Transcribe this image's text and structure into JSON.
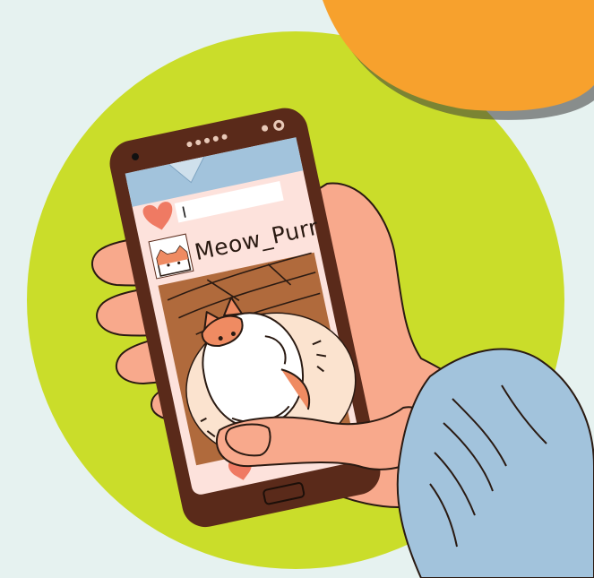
{
  "palette": {
    "background": "#e6f2f0",
    "lime_circle": "#cadd2a",
    "orange_blob": "#f7a12d",
    "skin": "#f8a98c",
    "phone_body": "#5a2a1a",
    "screen": "#fde2dc",
    "header_bar": "#a2c3dc",
    "sleeve": "#a2c3dc",
    "heart": "#ef7a63",
    "cat_orange": "#ef8b62",
    "cat_white": "#ffffff",
    "floor_brown": "#b06a3c",
    "cushion": "#fbe3cf"
  },
  "post": {
    "username": "Meow_Purr",
    "search_text": "I"
  },
  "icons": {
    "like": "heart-icon",
    "camera": "camera-icon",
    "speaker": "speaker-dots-icon",
    "home_button": "home-button-icon"
  }
}
